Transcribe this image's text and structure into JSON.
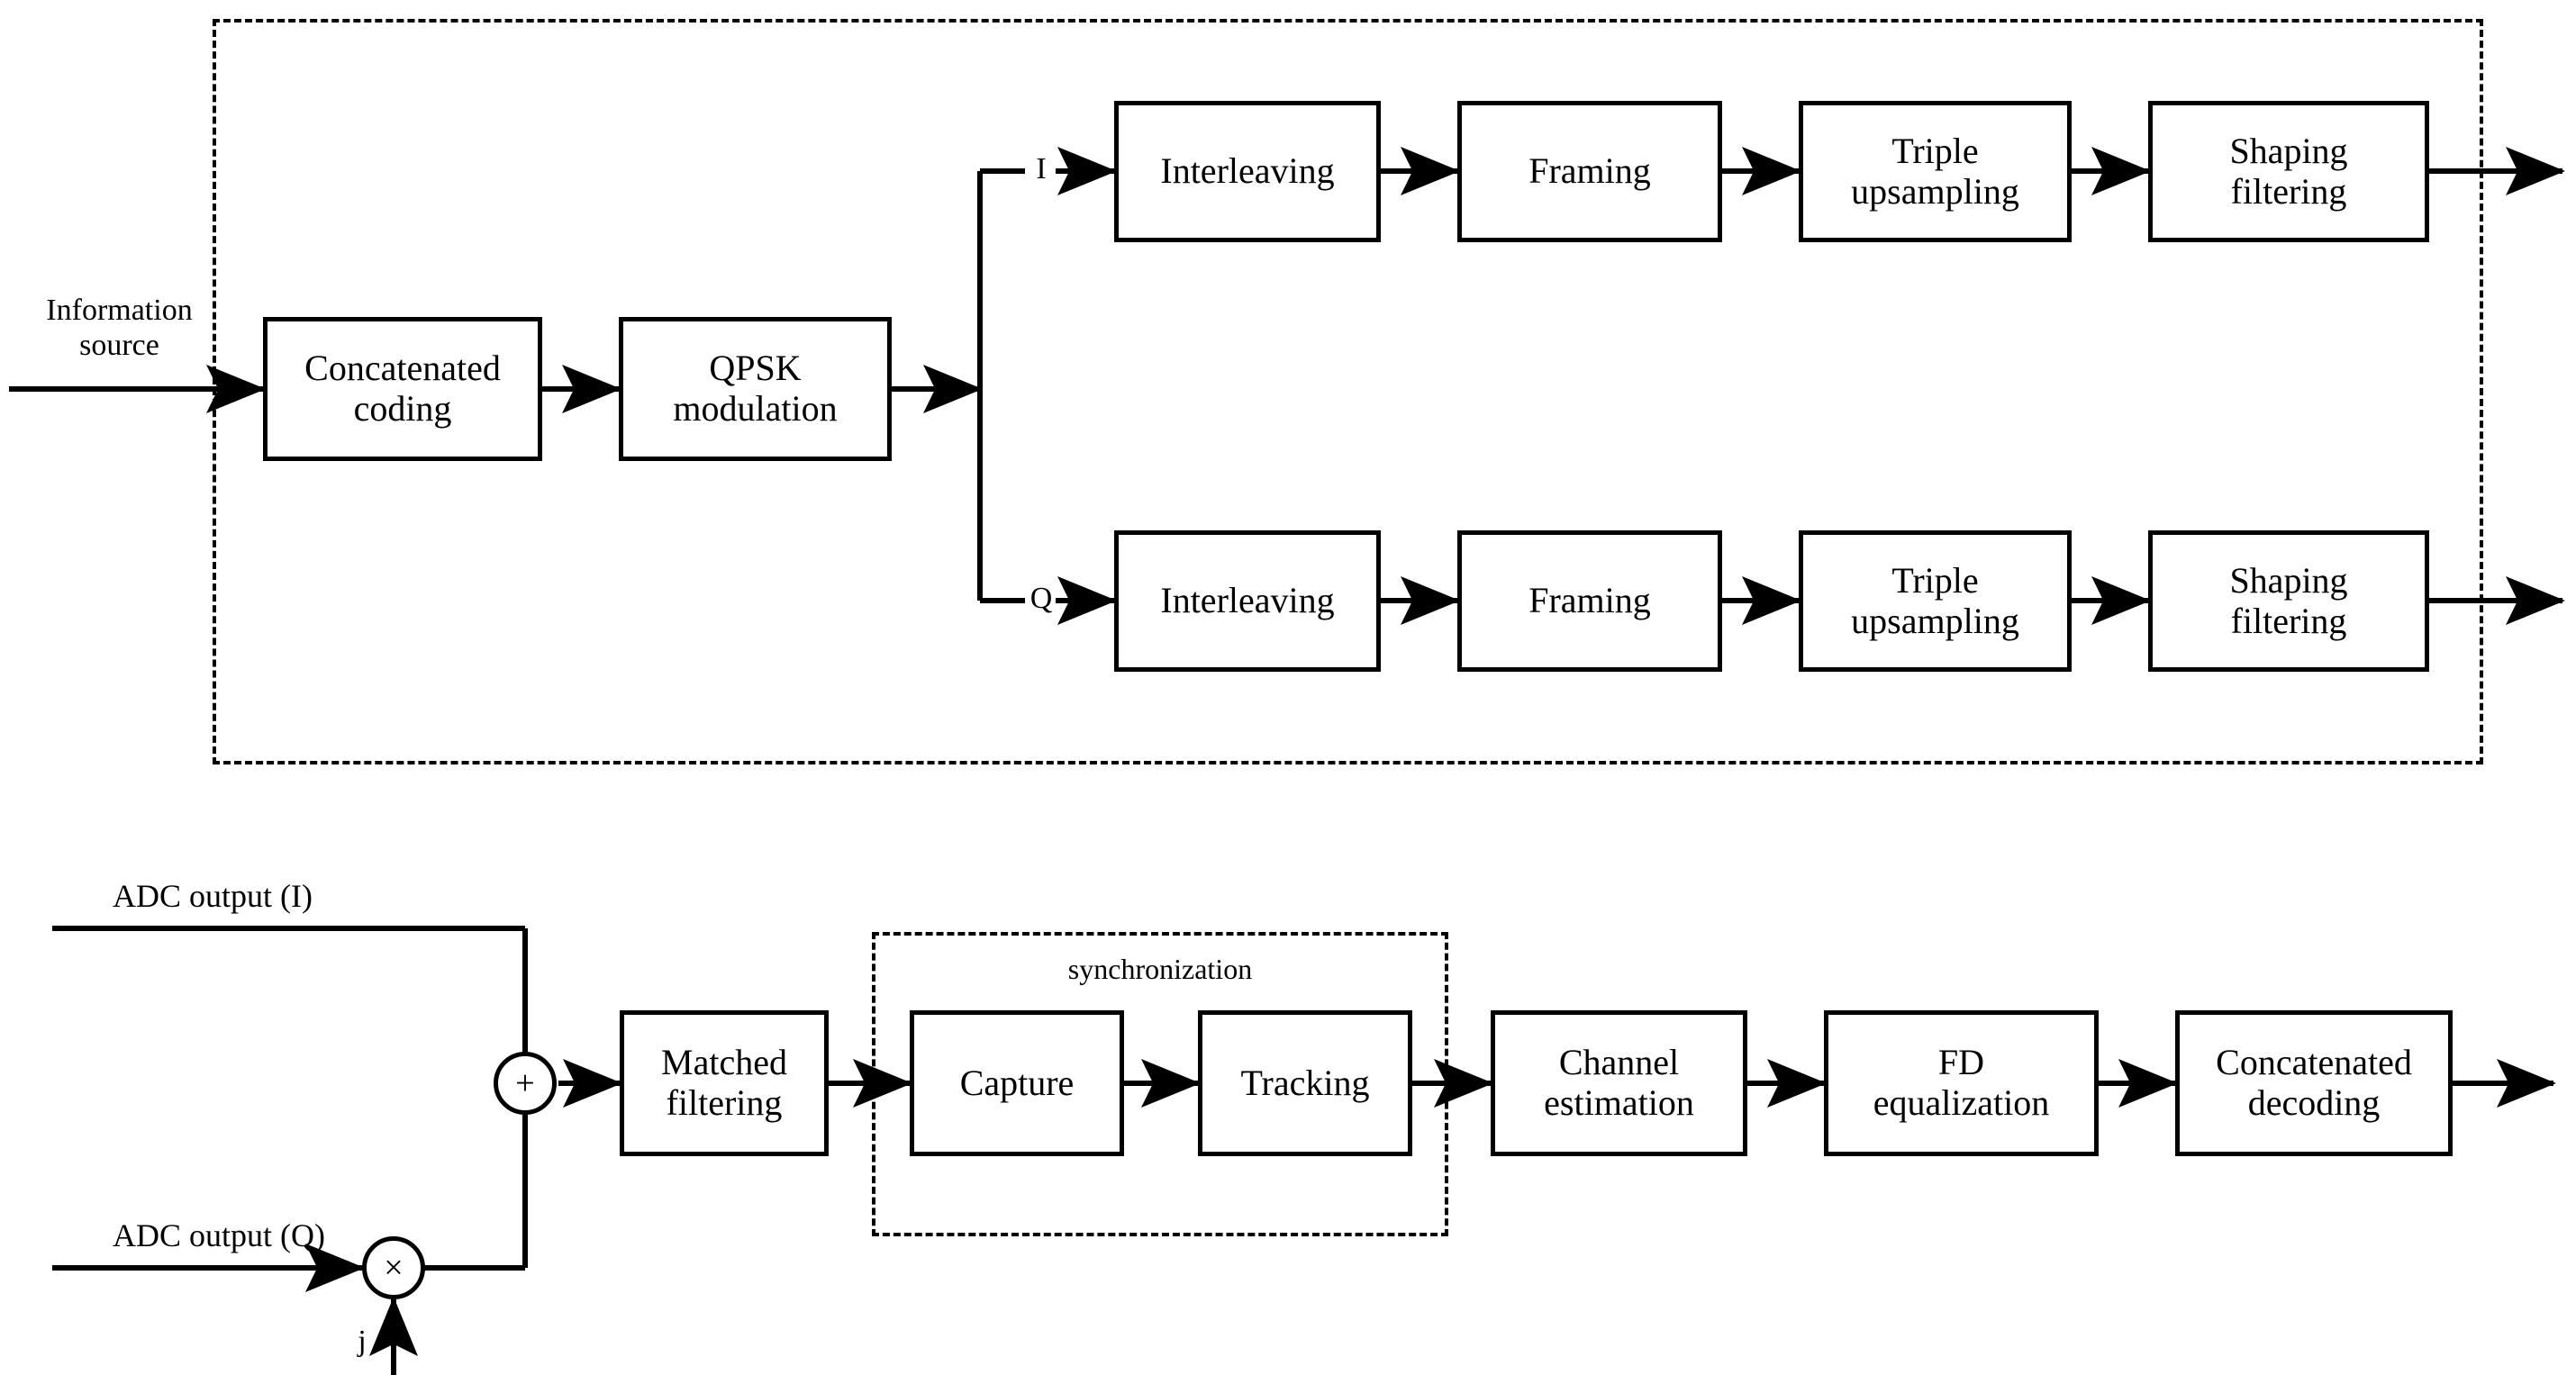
{
  "figure": {
    "kind": "communication-system-block-diagram",
    "line_color": "#000000",
    "background_color": "#ffffff"
  },
  "transmitter": {
    "boundary_label": "",
    "input_label": "Information\nsource",
    "input_label_line1": "Information",
    "input_label_line2": "source",
    "blocks": [
      {
        "id": "concatenated-coding",
        "line1": "Concatenated",
        "line2": "coding"
      },
      {
        "id": "qpsk-modulation",
        "line1": "QPSK",
        "line2": "modulation"
      }
    ],
    "branch_labels": {
      "i": "I",
      "q": "Q"
    },
    "i_chain": [
      {
        "id": "interleaving-i",
        "line1": "Interleaving",
        "line2": ""
      },
      {
        "id": "framing-i",
        "line1": "Framing",
        "line2": ""
      },
      {
        "id": "triple-upsampling-i",
        "line1": "Triple",
        "line2": "upsampling"
      },
      {
        "id": "shaping-filtering-i",
        "line1": "Shaping",
        "line2": "filtering"
      }
    ],
    "q_chain": [
      {
        "id": "interleaving-q",
        "line1": "Interleaving",
        "line2": ""
      },
      {
        "id": "framing-q",
        "line1": "Framing",
        "line2": ""
      },
      {
        "id": "triple-upsampling-q",
        "line1": "Triple",
        "line2": "upsampling"
      },
      {
        "id": "shaping-filtering-q",
        "line1": "Shaping",
        "line2": "filtering"
      }
    ]
  },
  "receiver": {
    "input_i_label": "ADC output (I)",
    "input_q_label": "ADC output (Q)",
    "imaginary_unit_label": "j",
    "sum_operator": "+",
    "multiply_operator": "×",
    "sync_group_label": "synchronization",
    "blocks": [
      {
        "id": "matched-filtering",
        "line1": "Matched",
        "line2": "filtering"
      },
      {
        "id": "capture",
        "line1": "Capture",
        "line2": ""
      },
      {
        "id": "tracking",
        "line1": "Tracking",
        "line2": ""
      },
      {
        "id": "channel-estimation",
        "line1": "Channel",
        "line2": "estimation"
      },
      {
        "id": "fd-equalization",
        "line1": "FD",
        "line2": "equalization"
      },
      {
        "id": "concatenated-decoding",
        "line1": "Concatenated",
        "line2": "decoding"
      }
    ]
  }
}
